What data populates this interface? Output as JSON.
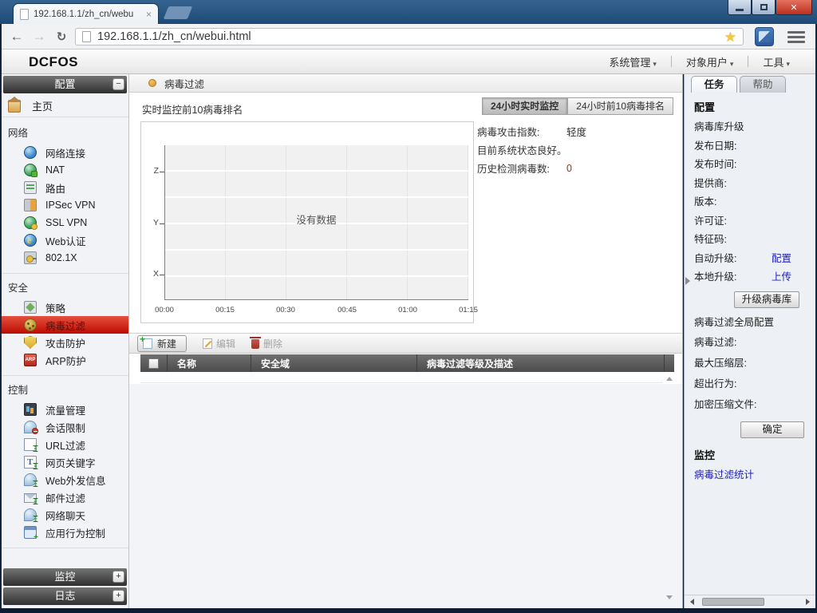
{
  "browser": {
    "tab": {
      "title": "192.168.1.1/zh_cn/webu",
      "close": "×"
    },
    "url": "192.168.1.1/zh_cn/webui.html"
  },
  "app_header": {
    "logo": "DCFOS",
    "menus": [
      {
        "label": "系统管理"
      },
      {
        "label": "对象用户"
      },
      {
        "label": "工具"
      }
    ]
  },
  "sidebar": {
    "header": {
      "title": "配置"
    },
    "home_label": "主页",
    "sections": [
      {
        "title": "网络",
        "items": [
          {
            "label": "网络连接"
          },
          {
            "label": "NAT"
          },
          {
            "label": "路由"
          },
          {
            "label": "IPSec VPN"
          },
          {
            "label": "SSL VPN"
          },
          {
            "label": "Web认证"
          },
          {
            "label": "802.1X"
          }
        ]
      },
      {
        "title": "安全",
        "items": [
          {
            "label": "策略"
          },
          {
            "label": "病毒过滤",
            "selected": true
          },
          {
            "label": "攻击防护"
          },
          {
            "label": "ARP防护"
          }
        ]
      },
      {
        "title": "控制",
        "items": [
          {
            "label": "流量管理"
          },
          {
            "label": "会话限制"
          },
          {
            "label": "URL过滤"
          },
          {
            "label": "网页关键字"
          },
          {
            "label": "Web外发信息"
          },
          {
            "label": "邮件过滤"
          },
          {
            "label": "网络聊天"
          },
          {
            "label": "应用行为控制"
          }
        ]
      }
    ],
    "bottom_bars": [
      {
        "label": "监控"
      },
      {
        "label": "日志"
      }
    ]
  },
  "main": {
    "title": "病毒过滤",
    "chart_caption": "实时监控前10病毒排名",
    "toggles": [
      {
        "label": "24小时实时监控",
        "active": true
      },
      {
        "label": "24小时前10病毒排名",
        "active": false
      }
    ],
    "stats": {
      "attack_index_label": "病毒攻击指数:",
      "attack_index_value": "轻度",
      "status_text": "目前系统状态良好。",
      "history_label": "历史检测病毒数:",
      "history_value": "0"
    },
    "toolbar": {
      "new_label": "新建",
      "edit_label": "编辑",
      "delete_label": "删除"
    },
    "table": {
      "columns": [
        "名称",
        "安全域",
        "病毒过滤等级及描述"
      ]
    }
  },
  "right_panel": {
    "tabs": [
      {
        "label": "任务",
        "active": true
      },
      {
        "label": "帮助",
        "active": false
      }
    ],
    "sections": {
      "config_heading": "配置",
      "upgrade_title": "病毒库升级",
      "fields": [
        {
          "label": "发布日期:"
        },
        {
          "label": "发布时间:"
        },
        {
          "label": "提供商:"
        },
        {
          "label": "版本:"
        },
        {
          "label": "许可证:"
        },
        {
          "label": "特征码:"
        },
        {
          "label": "自动升级:",
          "link": "配置"
        },
        {
          "label": "本地升级:",
          "link": "上传"
        }
      ],
      "upgrade_button": "升级病毒库",
      "global_title": "病毒过滤全局配置",
      "global_fields": [
        {
          "label": "病毒过滤:"
        },
        {
          "label": "最大压缩层:"
        },
        {
          "label": "超出行为:"
        },
        {
          "label": "加密压缩文件:"
        }
      ],
      "ok_button": "确定",
      "monitor_heading": "监控",
      "monitor_link": "病毒过滤统计"
    }
  },
  "chart_data": {
    "type": "line",
    "title": "实时监控前10病毒排名",
    "x_ticks": [
      "00:00",
      "00:15",
      "00:30",
      "00:45",
      "01:00",
      "01:15"
    ],
    "y_ticks": [
      "Z",
      "Y",
      "X"
    ],
    "series": [],
    "no_data_label": "没有数据",
    "grid": true,
    "legend": "none",
    "plot_bg": "#f1f1f1"
  },
  "colors": {
    "selected_red": "#bd0b00",
    "link_blue": "#2222bb",
    "titlebar_blue": "#2a5685",
    "status_orange": "#d8912a"
  }
}
